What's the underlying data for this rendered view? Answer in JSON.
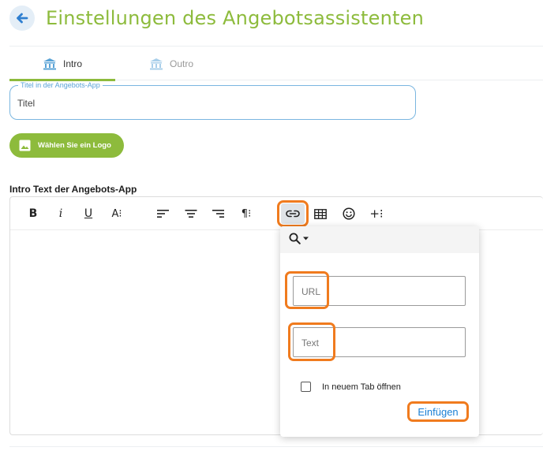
{
  "header": {
    "title": "Einstellungen des Angebotsassistenten",
    "back_icon": "arrow-left-icon"
  },
  "tabs": [
    {
      "label": "Intro",
      "icon": "bank-icon",
      "active": true
    },
    {
      "label": "Outro",
      "icon": "bank-icon",
      "active": false
    }
  ],
  "title_field": {
    "label": "Titel in der Angebots-App",
    "value": "Titel"
  },
  "logo_button": {
    "label": "Wählen Sie ein Logo",
    "icon": "image-icon"
  },
  "editor": {
    "section_label": "Intro Text der Angebots-App",
    "toolbar": {
      "bold": "B",
      "italic": "i",
      "underline": "U",
      "font_size": "A⁝",
      "paragraph": "¶⁝",
      "more": "+⁝"
    }
  },
  "link_popup": {
    "url_placeholder": "URL",
    "text_placeholder": "Text",
    "new_tab_label": "In neuem Tab öffnen",
    "new_tab_checked": false,
    "insert_label": "Einfügen"
  },
  "colors": {
    "accent_green": "#8dbb3c",
    "field_blue": "#7ab6e0",
    "link_blue": "#1a7fd4",
    "highlight_orange": "#f07b1e"
  }
}
